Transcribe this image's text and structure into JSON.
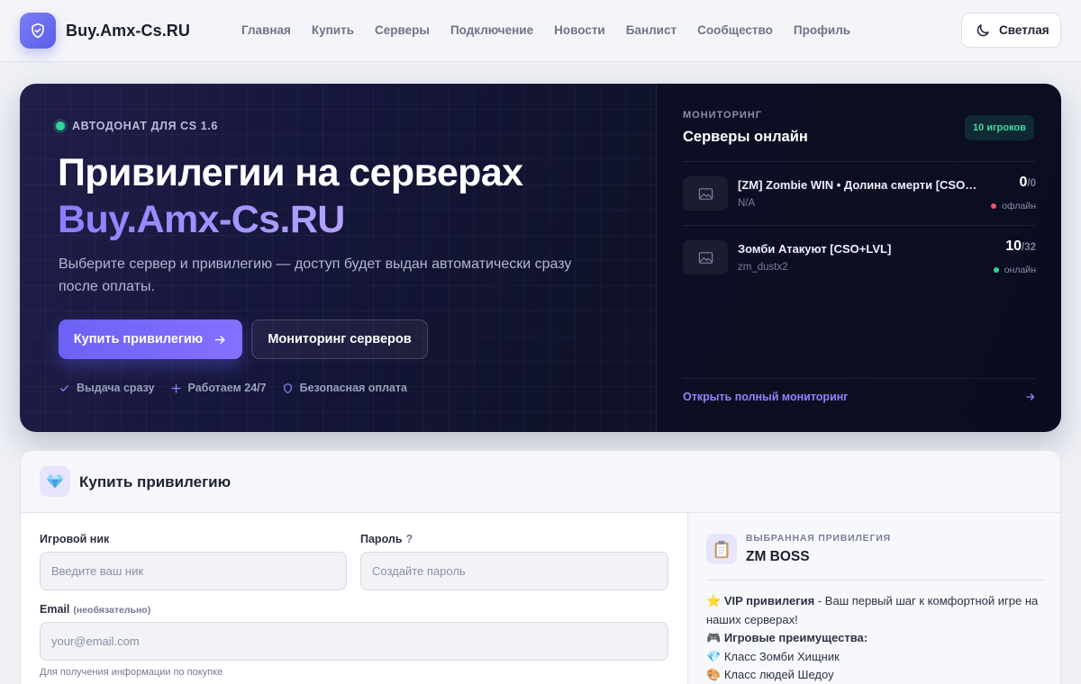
{
  "header": {
    "brand": "Buy.Amx-Cs.RU",
    "nav": [
      "Главная",
      "Купить",
      "Серверы",
      "Подключение",
      "Новости",
      "Банлист",
      "Сообщество",
      "Профиль"
    ],
    "theme_label": "Светлая",
    "icons": {
      "logo": "shield-check-icon",
      "theme": "moon-icon"
    }
  },
  "hero": {
    "tagline": "АВТОДОНАТ ДЛЯ CS 1.6",
    "title": "Привилегии на серверах",
    "title_accent": "Buy.Amx-Cs.RU",
    "description": "Выберите сервер и привилегию — доступ будет выдан автоматически сразу после оплаты.",
    "buy_button": "Купить привилегию",
    "monitor_button": "Мониторинг серверов",
    "features": [
      {
        "icon": "check-icon",
        "label": "Выдача сразу"
      },
      {
        "icon": "plus-icon",
        "label": "Работаем 24/7"
      },
      {
        "icon": "shield-icon",
        "label": "Безопасная оплата"
      }
    ],
    "colors": {
      "accent": "#7c6cff",
      "online": "#34d399",
      "offline": "#f0506e"
    }
  },
  "monitoring": {
    "kicker": "МОНИТОРИНГ",
    "title": "Серверы онлайн",
    "badge": "10 игроков",
    "servers": [
      {
        "name": "[ZM] Zombie WIN • Долина смерти [CSO+LVL]",
        "map": "N/A",
        "players": "0",
        "max": "/0",
        "status": "офлайн",
        "online": false
      },
      {
        "name": "Зомби Атакуют [CSO+LVL]",
        "map": "zm_dustx2",
        "players": "10",
        "max": "/32",
        "status": "онлайн",
        "online": true
      }
    ],
    "footer_link": "Открыть полный мониторинг"
  },
  "buy": {
    "title": "Купить привилегию",
    "nick_label": "Игровой ник",
    "nick_placeholder": "Введите ваш ник",
    "password_label": "Пароль",
    "password_help": "?",
    "password_placeholder": "Создайте пароль",
    "email_label": "Email",
    "email_optional": "(необязательно)",
    "email_placeholder": "your@email.com",
    "email_hint": "Для получения информации по покупке"
  },
  "selected": {
    "kicker": "ВЫБРАННАЯ ПРИВИЛЕГИЯ",
    "name": "ZM BOSS",
    "lines": [
      {
        "emoji": "⭐",
        "bold": "VIP привилегия",
        "text": " - Ваш первый шаг к комфортной игре на наших серверах!"
      },
      {
        "emoji": "🎮",
        "bold": "Игровые преимущества:",
        "text": ""
      },
      {
        "emoji": "💎",
        "bold": "",
        "text": "Класс Зомби Хищник"
      },
      {
        "emoji": "🎨",
        "bold": "",
        "text": "Класс людей Шедоу"
      }
    ]
  }
}
